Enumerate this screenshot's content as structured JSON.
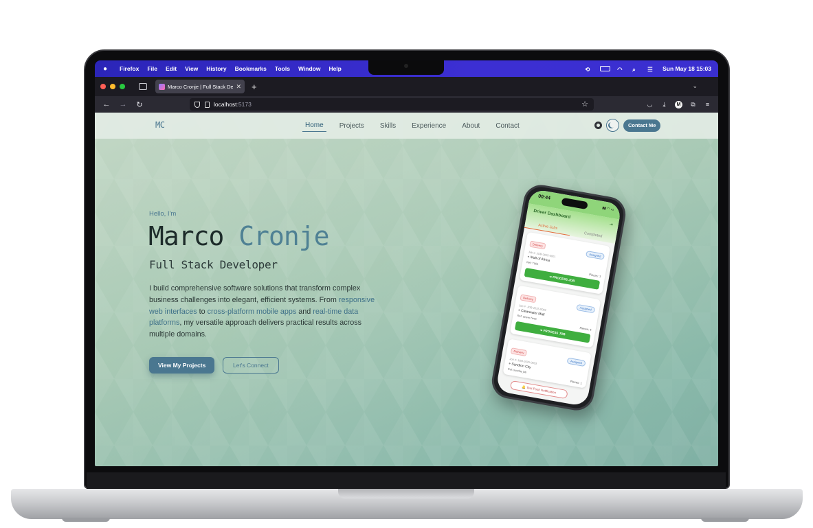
{
  "menubar": {
    "items": [
      "Firefox",
      "File",
      "Edit",
      "View",
      "History",
      "Bookmarks",
      "Tools",
      "Window",
      "Help"
    ],
    "datetime": "Sun May 18  15:03"
  },
  "browser": {
    "tab_title": "Marco Cronje | Full Stack Developer",
    "url_host": "localhost",
    "url_port": ":5173",
    "traffic_colors": [
      "#ff5f57",
      "#febc2e",
      "#28c840"
    ]
  },
  "site": {
    "logo": "MC",
    "nav": [
      "Home",
      "Projects",
      "Skills",
      "Experience",
      "About",
      "Contact"
    ],
    "active_nav": "Home",
    "contact_button": "Contact Me",
    "accent": "#4a7790"
  },
  "hero": {
    "greeting": "Hello, I'm",
    "first_name": "Marco",
    "last_name": "Cronje",
    "role": "Full Stack Developer",
    "desc_1": "I build comprehensive software solutions that transform complex business challenges into elegant, efficient systems. From ",
    "link_1": "responsive web interfaces",
    "desc_2": " to ",
    "link_2": "cross-platform mobile apps",
    "desc_3": " and ",
    "link_3": "real-time data platforms",
    "desc_4": ", my versatile approach delivers practical results across multiple domains.",
    "primary_cta": "View My Projects",
    "secondary_cta": "Let's Connect"
  },
  "phone": {
    "time": "00:44",
    "title": "Driver Dashboard",
    "tabs": [
      "Active Jobs",
      "Completed"
    ],
    "jobs": [
      {
        "type": "Delivery",
        "status": "Assigned",
        "id": "Job #: JOB-2025-0001",
        "location": "Mall of Africa",
        "ref": "Ref: T001",
        "pieces": "Pieces: 1",
        "action": "PROCESS JOB"
      },
      {
        "type": "Delivery",
        "status": "Assigned",
        "id": "Job #: JOB-2025-0002",
        "location": "Clearwater Mall",
        "ref": "Ref: sewer hose",
        "pieces": "Pieces: 4",
        "action": "PROCESS JOB"
      },
      {
        "type": "Delivery",
        "status": "Assigned",
        "id": "Job #: JOB-2025-0003",
        "location": "Sandton City",
        "ref": "Ref: sunday job",
        "pieces": "Pieces: 1",
        "action": ""
      }
    ],
    "test_button": "Test Push Notification"
  }
}
